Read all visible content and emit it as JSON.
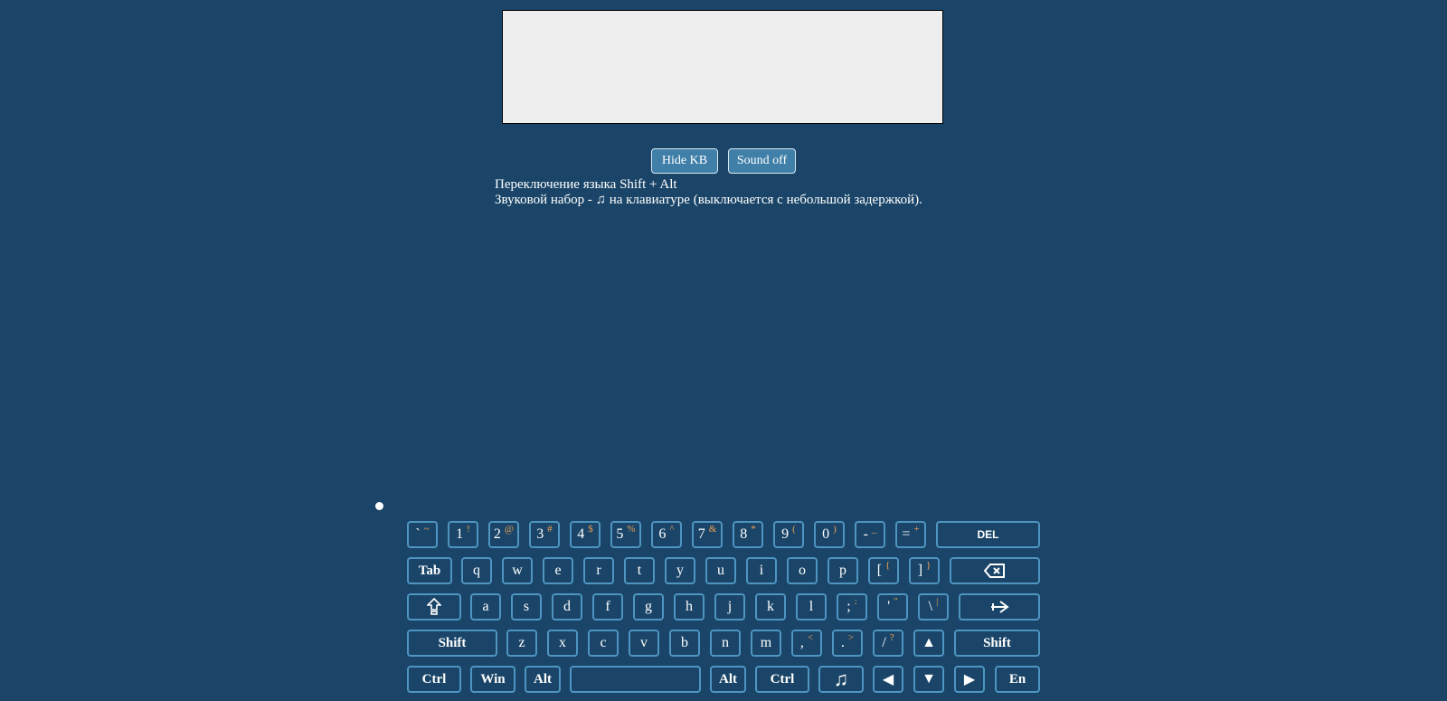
{
  "editor": {
    "value": "",
    "placeholder": ""
  },
  "buttons": {
    "hide_kb": "Hide KB",
    "sound": "Sound off"
  },
  "info": {
    "line1": "Переключение языка Shift + Alt",
    "line2_pre": "Звуковой набор - ",
    "line2_post": " на клавиатуре (выключается с небольшой задержкой)."
  },
  "keys": {
    "row1": [
      {
        "m": "`",
        "a": "~"
      },
      {
        "m": "1",
        "a": "!"
      },
      {
        "m": "2",
        "a": "@"
      },
      {
        "m": "3",
        "a": "#"
      },
      {
        "m": "4",
        "a": "$"
      },
      {
        "m": "5",
        "a": "%"
      },
      {
        "m": "6",
        "a": "^"
      },
      {
        "m": "7",
        "a": "&"
      },
      {
        "m": "8",
        "a": "*"
      },
      {
        "m": "9",
        "a": "("
      },
      {
        "m": "0",
        "a": ")"
      },
      {
        "m": "-",
        "a": "_"
      },
      {
        "m": "=",
        "a": "+"
      },
      {
        "m": "DEL",
        "a": ""
      }
    ],
    "row2": [
      {
        "m": "Tab",
        "a": ""
      },
      {
        "m": "q",
        "a": ""
      },
      {
        "m": "w",
        "a": ""
      },
      {
        "m": "e",
        "a": ""
      },
      {
        "m": "r",
        "a": ""
      },
      {
        "m": "t",
        "a": ""
      },
      {
        "m": "y",
        "a": ""
      },
      {
        "m": "u",
        "a": ""
      },
      {
        "m": "i",
        "a": ""
      },
      {
        "m": "o",
        "a": ""
      },
      {
        "m": "p",
        "a": ""
      },
      {
        "m": "[",
        "a": "{"
      },
      {
        "m": "]",
        "a": "}"
      },
      {
        "m": "",
        "a": ""
      }
    ],
    "row3": [
      {
        "m": "",
        "a": ""
      },
      {
        "m": "a",
        "a": ""
      },
      {
        "m": "s",
        "a": ""
      },
      {
        "m": "d",
        "a": ""
      },
      {
        "m": "f",
        "a": ""
      },
      {
        "m": "g",
        "a": ""
      },
      {
        "m": "h",
        "a": ""
      },
      {
        "m": "j",
        "a": ""
      },
      {
        "m": "k",
        "a": ""
      },
      {
        "m": "l",
        "a": ""
      },
      {
        "m": ";",
        "a": ":"
      },
      {
        "m": "'",
        "a": "\""
      },
      {
        "m": "\\",
        "a": "|"
      },
      {
        "m": "",
        "a": ""
      }
    ],
    "row4": [
      {
        "m": "Shift",
        "a": ""
      },
      {
        "m": "z",
        "a": ""
      },
      {
        "m": "x",
        "a": ""
      },
      {
        "m": "c",
        "a": ""
      },
      {
        "m": "v",
        "a": ""
      },
      {
        "m": "b",
        "a": ""
      },
      {
        "m": "n",
        "a": ""
      },
      {
        "m": "m",
        "a": ""
      },
      {
        "m": ",",
        "a": "<"
      },
      {
        "m": ".",
        "a": ">"
      },
      {
        "m": "/",
        "a": "?"
      },
      {
        "m": "▲",
        "a": ""
      },
      {
        "m": "Shift",
        "a": ""
      }
    ],
    "row5": [
      {
        "m": "Ctrl",
        "a": ""
      },
      {
        "m": "Win",
        "a": ""
      },
      {
        "m": "Alt",
        "a": ""
      },
      {
        "m": "",
        "a": ""
      },
      {
        "m": "Alt",
        "a": ""
      },
      {
        "m": "Ctrl",
        "a": ""
      },
      {
        "m": "",
        "a": ""
      },
      {
        "m": "◀",
        "a": ""
      },
      {
        "m": "▼",
        "a": ""
      },
      {
        "m": "▶",
        "a": ""
      },
      {
        "m": "En",
        "a": ""
      }
    ]
  },
  "icons": {
    "backspace": "backspace-icon",
    "caps": "caps-lock-icon",
    "enter": "enter-icon",
    "music": "music-note-icon"
  },
  "colors": {
    "background": "#1a4568",
    "key_border": "#4e95c2",
    "alt_char": "#f0a050",
    "button": "#3f7fa8"
  }
}
